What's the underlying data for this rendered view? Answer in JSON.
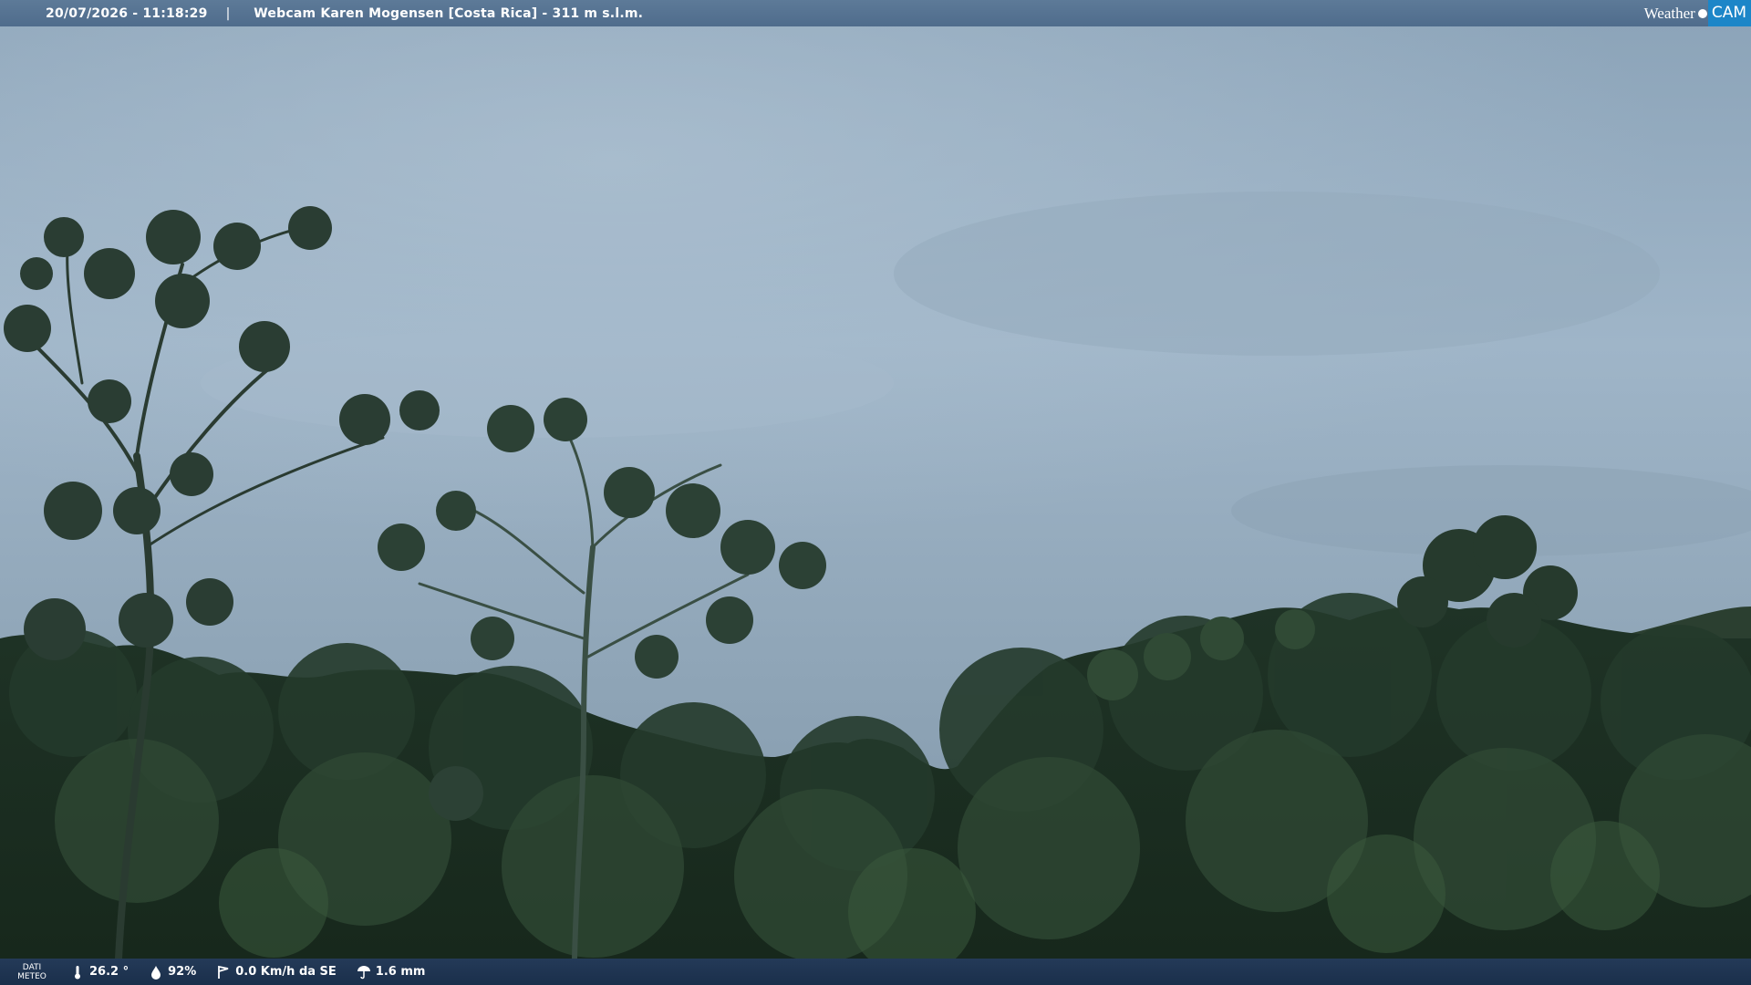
{
  "header": {
    "timestamp": "20/07/2026 - 11:18:29",
    "separator": "|",
    "title": "Webcam Karen Mogensen [Costa Rica] - 311 m s.l.m."
  },
  "brand": {
    "weather_text": "Weather",
    "cam_text": "CAM",
    "accent_color": "#1c86c8"
  },
  "weather_bar": {
    "label_line1": "DATI",
    "label_line2": "METEO",
    "temperature": "26.2 °",
    "humidity": "92%",
    "wind": "0.0 Km/h da SE",
    "rain": "1.6 mm",
    "icons": [
      "thermometer-icon",
      "humidity-icon",
      "wind-icon",
      "rain-icon"
    ]
  }
}
